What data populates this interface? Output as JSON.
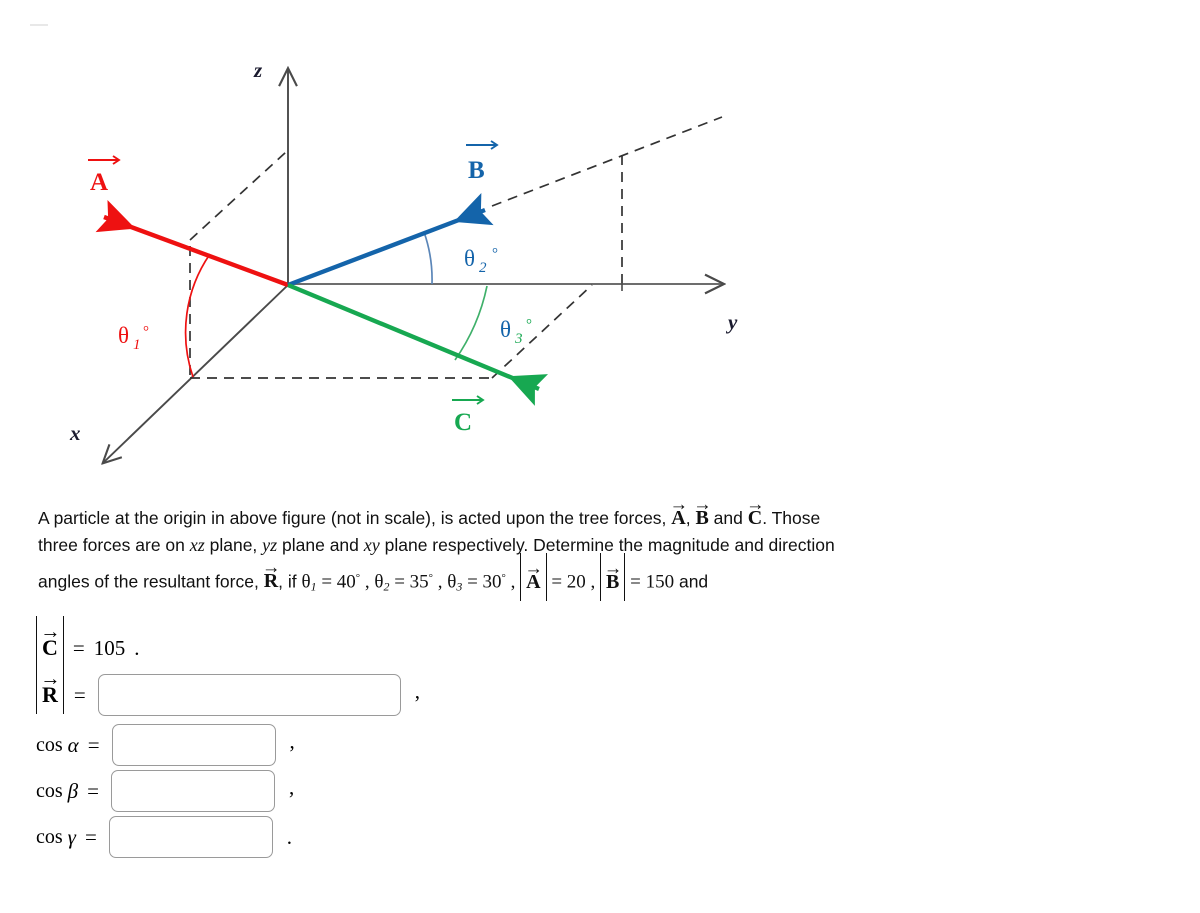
{
  "figure": {
    "axes": [
      {
        "name": "z-axis",
        "label": "z"
      },
      {
        "name": "y-axis",
        "label": "y"
      },
      {
        "name": "x-axis",
        "label": "x"
      }
    ],
    "vectors": [
      {
        "name": "vector-a",
        "label": "A",
        "color": "#ee1111",
        "plane": "xz"
      },
      {
        "name": "vector-b",
        "label": "B",
        "color": "#1464aa",
        "plane": "yz"
      },
      {
        "name": "vector-c",
        "label": "C",
        "color": "#17a851",
        "plane": "xy"
      }
    ],
    "angles": [
      {
        "name": "theta-1",
        "symbol": "θ",
        "subscript": "1",
        "degree": "°",
        "color": "#ee1111"
      },
      {
        "name": "theta-2",
        "symbol": "θ",
        "subscript": "2",
        "degree": "°",
        "color": "#1464aa"
      },
      {
        "name": "theta-3",
        "symbol": "θ",
        "subscript": "3",
        "degree": "°",
        "color": "#17a851"
      }
    ]
  },
  "statement": {
    "l1_a": "A particle at the origin in above figure (not in scale), is acted upon the tree forces, ",
    "l1_vecA": "A",
    "l1_comma": ", ",
    "l1_vecB": "B",
    "l1_and": " and ",
    "l1_vecC": "C",
    "l1_end": ". Those",
    "l2_a": "three forces are on ",
    "l2_p1": "xz",
    "l2_b": " plane, ",
    "l2_p2": "yz",
    "l2_c": " plane and ",
    "l2_p3": "xy",
    "l2_d": " plane respectively. Determine the magnitude and direction",
    "l3_a": "angles of the resultant force, ",
    "l3_vecR": "R",
    "l3_b": ", if ",
    "theta": "θ",
    "sub1": "1",
    "eq1": " = ",
    "val1": "40",
    "deg": "°",
    "sub2": "2",
    "val2": "35",
    "sub3": "3",
    "val3": "30",
    "vecA": "A",
    "valA": "20",
    "vecB": "B",
    "valB": "150",
    "l3_and": " and",
    "comma": " , ",
    "equals": " = "
  },
  "answers": {
    "magnitude_c": {
      "vector": "C",
      "equals": "=",
      "value": "105",
      "terminator": "."
    },
    "magnitude_r": {
      "vector": "R",
      "equals": "=",
      "value": "",
      "placeholder": "",
      "terminator": ","
    },
    "fields": [
      {
        "label": "cos",
        "greek": "α",
        "equals": "=",
        "value": "",
        "placeholder": "",
        "terminator": ","
      },
      {
        "label": "cos",
        "greek": "β",
        "equals": "=",
        "value": "",
        "placeholder": "",
        "terminator": ","
      },
      {
        "label": "cos",
        "greek": "γ",
        "equals": "=",
        "value": "",
        "placeholder": "",
        "terminator": "."
      }
    ]
  },
  "colors": {
    "vector_a": "#ee1111",
    "vector_b": "#1464aa",
    "vector_c": "#17a851",
    "axis": "#4a4a4a",
    "dashed": "#333333",
    "axis_label": "#1a1a2e",
    "input_border": "#9a9a9a"
  }
}
